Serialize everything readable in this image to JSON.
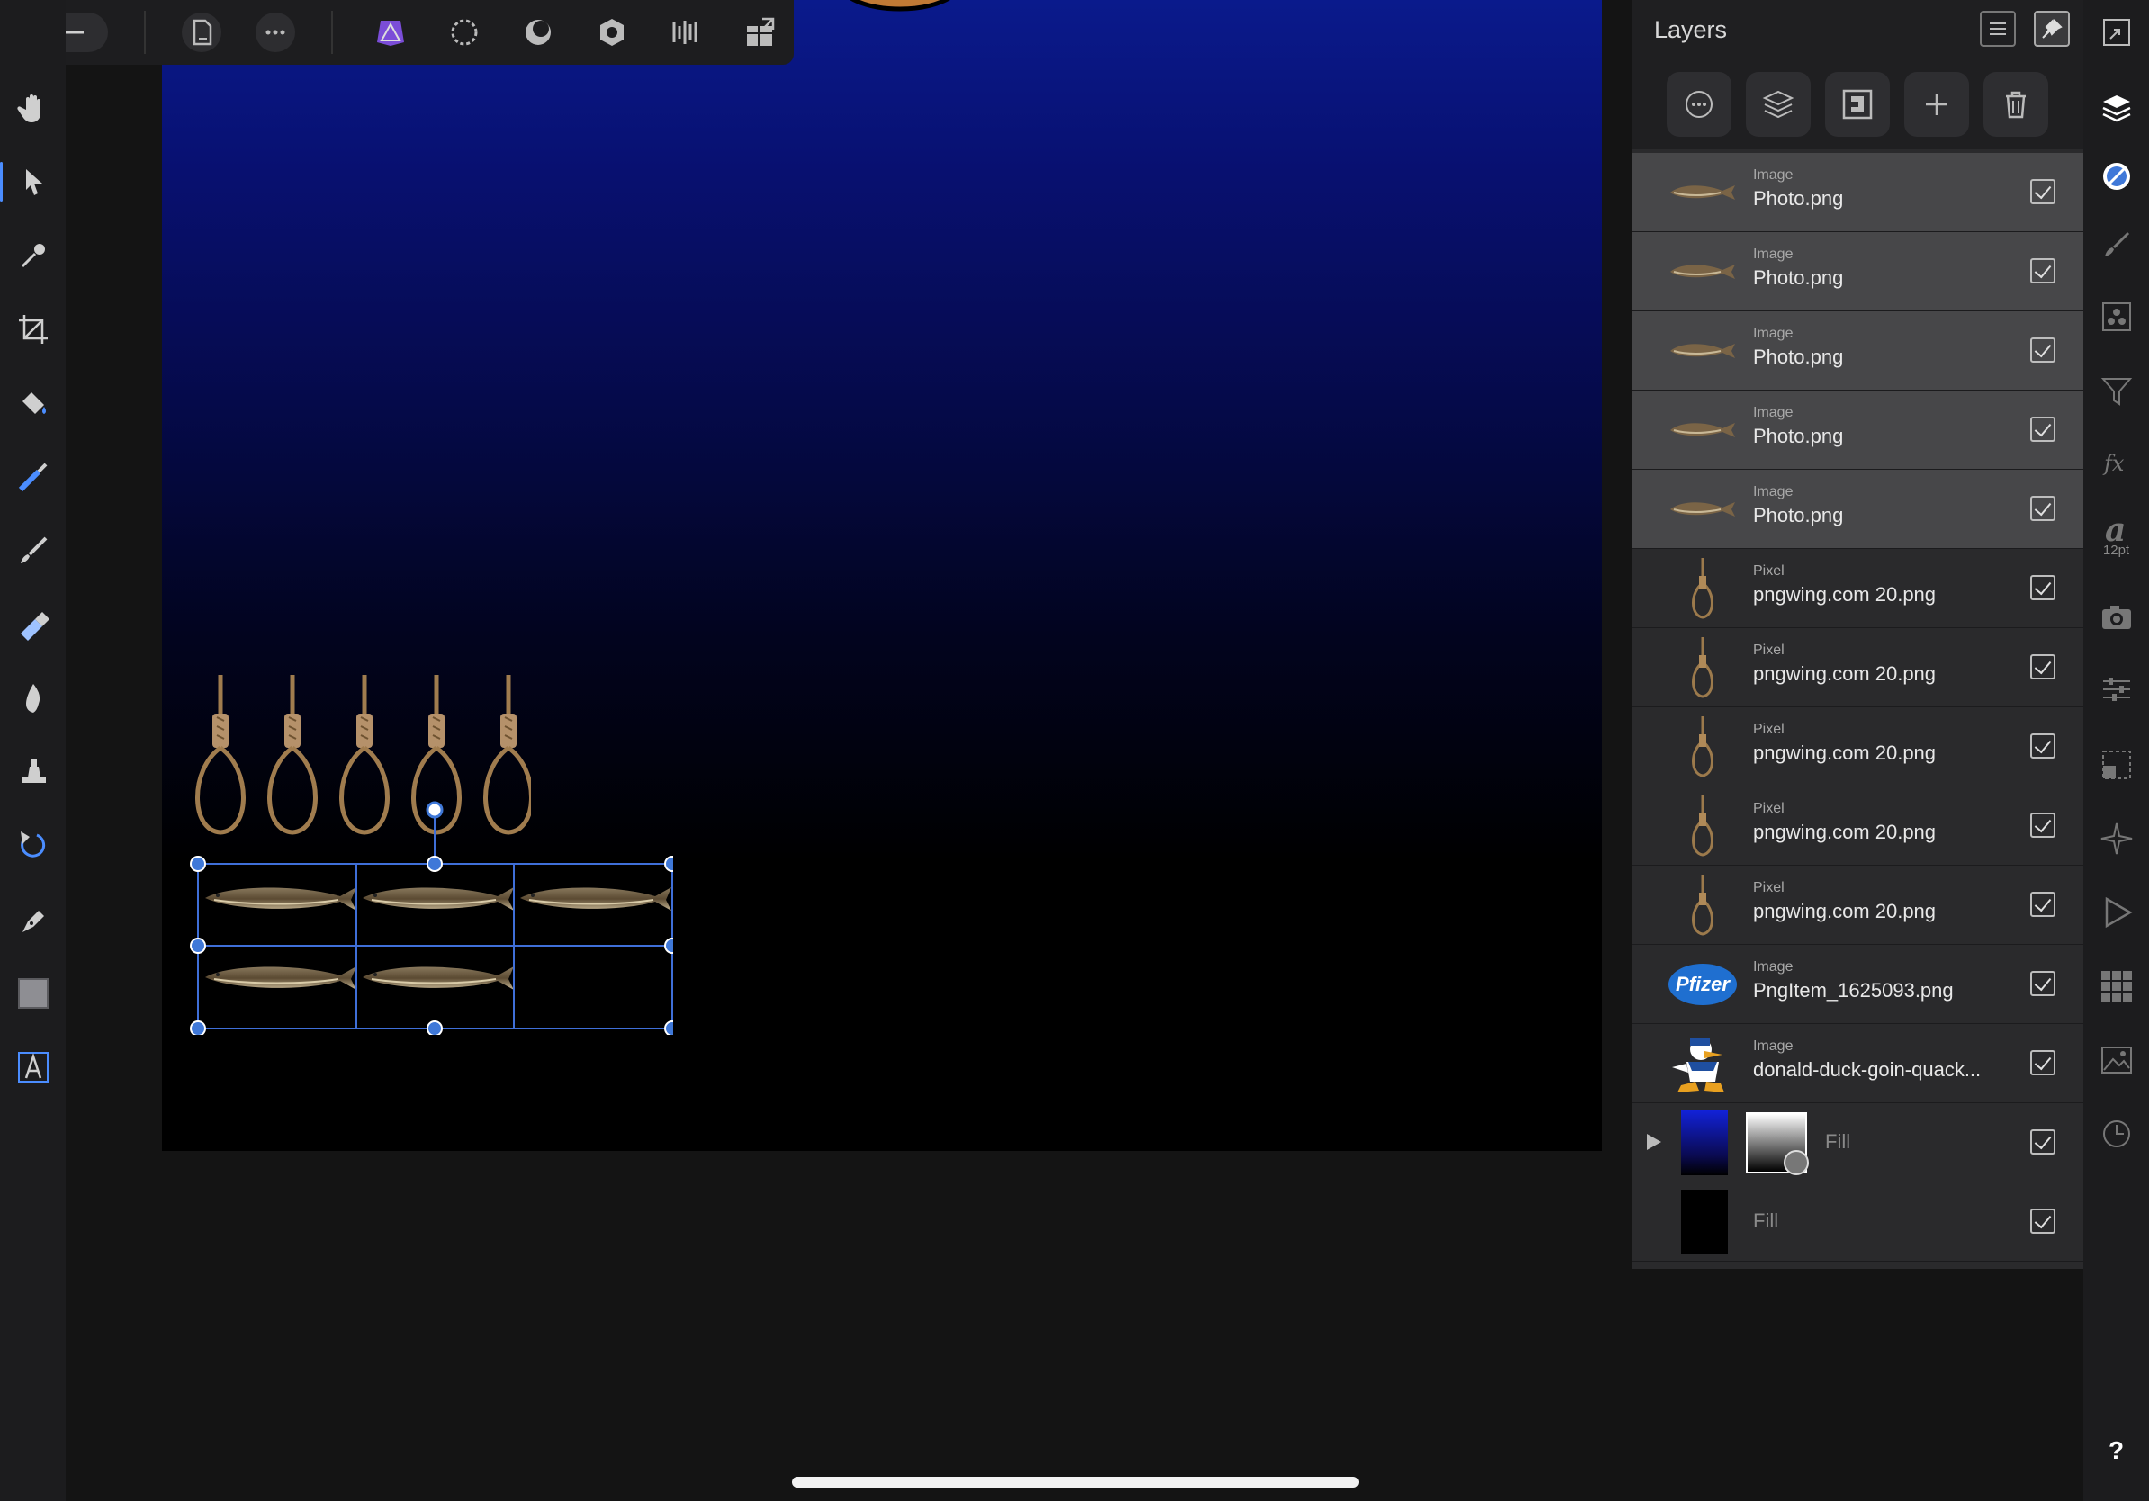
{
  "app": {
    "colors": {
      "accent": "#4b8dff",
      "panel": "#2a2a2c",
      "toolbar": "#1c1c1e",
      "selected_row": "#474749",
      "gradient_top": "#0a1a8c"
    }
  },
  "top_toolbar": {
    "icons": [
      "back-arrow-icon",
      "document-icon",
      "more-icon",
      "designer-persona-icon",
      "pixel-persona-icon",
      "liquify-persona-icon",
      "develop-persona-icon",
      "tone-mapping-persona-icon",
      "export-persona-icon"
    ]
  },
  "left_toolbar": {
    "tools": [
      "hand-icon",
      "move-icon",
      "color-picker-icon",
      "crop-icon",
      "flood-fill-icon",
      "selection-brush-icon",
      "paint-brush-icon",
      "erase-brush-icon",
      "burn-brush-icon",
      "clone-brush-icon",
      "healing-brush-icon",
      "pen-icon",
      "rectangle-icon",
      "text-icon"
    ],
    "active_tool": "move-icon"
  },
  "layers_panel": {
    "title": "Layers",
    "toolbar": [
      "layer-options-icon",
      "layer-stack-icon",
      "mask-icon",
      "add-layer-icon",
      "delete-layer-icon"
    ],
    "layers": [
      {
        "type": "Image",
        "name": "Photo.png",
        "thumb": "fish",
        "selected": true,
        "visible": true
      },
      {
        "type": "Image",
        "name": "Photo.png",
        "thumb": "fish",
        "selected": true,
        "visible": true
      },
      {
        "type": "Image",
        "name": "Photo.png",
        "thumb": "fish",
        "selected": true,
        "visible": true
      },
      {
        "type": "Image",
        "name": "Photo.png",
        "thumb": "fish",
        "selected": true,
        "visible": true
      },
      {
        "type": "Image",
        "name": "Photo.png",
        "thumb": "fish",
        "selected": true,
        "visible": true
      },
      {
        "type": "Pixel",
        "name": "pngwing.com 20.png",
        "thumb": "rope",
        "selected": false,
        "visible": true
      },
      {
        "type": "Pixel",
        "name": "pngwing.com 20.png",
        "thumb": "rope",
        "selected": false,
        "visible": true
      },
      {
        "type": "Pixel",
        "name": "pngwing.com 20.png",
        "thumb": "rope",
        "selected": false,
        "visible": true
      },
      {
        "type": "Pixel",
        "name": "pngwing.com 20.png",
        "thumb": "rope",
        "selected": false,
        "visible": true
      },
      {
        "type": "Pixel",
        "name": "pngwing.com 20.png",
        "thumb": "rope",
        "selected": false,
        "visible": true
      },
      {
        "type": "Image",
        "name": "PngItem_1625093.png",
        "thumb": "pfizer",
        "selected": false,
        "visible": true
      },
      {
        "type": "Image",
        "name": "donald-duck-goin-quack...",
        "thumb": "duck",
        "selected": false,
        "visible": true
      },
      {
        "type": "",
        "name": "Fill",
        "thumb": "gradient-with-mask",
        "selected": false,
        "visible": true,
        "expandable": true
      },
      {
        "type": "",
        "name": "Fill",
        "thumb": "black",
        "selected": false,
        "visible": true
      }
    ],
    "pfizer_text": "Pfizer"
  },
  "studio_rail": {
    "icons": [
      "transform-icon",
      "layers-icon",
      "color-icon",
      "brushes-icon",
      "channels-icon",
      "filter-icon",
      "fx-icon",
      "text-style-icon",
      "camera-icon",
      "adjustments-icon",
      "navigator-icon",
      "snapping-icon",
      "macro-icon",
      "swatches-icon",
      "image-icon",
      "history-icon",
      "help-icon"
    ],
    "font_size": "12pt",
    "help": "?"
  }
}
